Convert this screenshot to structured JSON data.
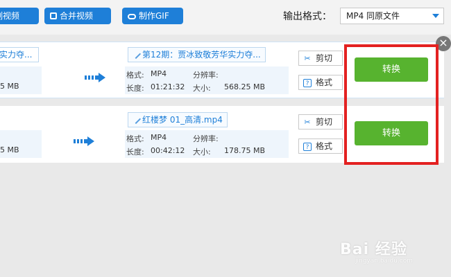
{
  "toolbar": {
    "cut_video_label": "剪切视频",
    "cut_video_visible": "割视频",
    "merge_video_label": "合并视频",
    "make_gif_label": "制作GIF",
    "output_format_label": "输出格式：",
    "output_format_value": "MP4  同原文件"
  },
  "items": [
    {
      "source_title": "实力夺...",
      "source_size": "5 MB",
      "dest_title": "第12期：贾冰致敬芳华实力夺...",
      "format_key": "格式:",
      "format_value": "MP4",
      "resolution_key": "分辨率:",
      "resolution_value": "",
      "duration_key": "长度:",
      "duration_value": "01:21:32",
      "size_key": "大小:",
      "size_value": "568.25 MB",
      "cut_label": "剪切",
      "format_button_label": "格式",
      "convert_label": "转换"
    },
    {
      "source_title": "",
      "source_size": "5 MB",
      "dest_title": "红楼梦 01_高清.mp4",
      "format_key": "格式:",
      "format_value": "MP4",
      "resolution_key": "分辨率:",
      "resolution_value": "",
      "duration_key": "长度:",
      "duration_value": "00:42:12",
      "size_key": "大小:",
      "size_value": "178.75 MB",
      "cut_label": "剪切",
      "format_button_label": "格式",
      "convert_label": "转换"
    }
  ],
  "icons": {
    "close": "close-icon",
    "arrow": "arrow-right-icon",
    "pen": "pencil-icon",
    "scissors": "scissors-icon",
    "question": "question-icon"
  },
  "colors": {
    "accent_blue": "#1e7fd8",
    "convert_green": "#57b32f",
    "highlight_red": "#e32121"
  },
  "watermark": {
    "brand": "Bai 经验",
    "url": "jingyan.baidu.com"
  }
}
